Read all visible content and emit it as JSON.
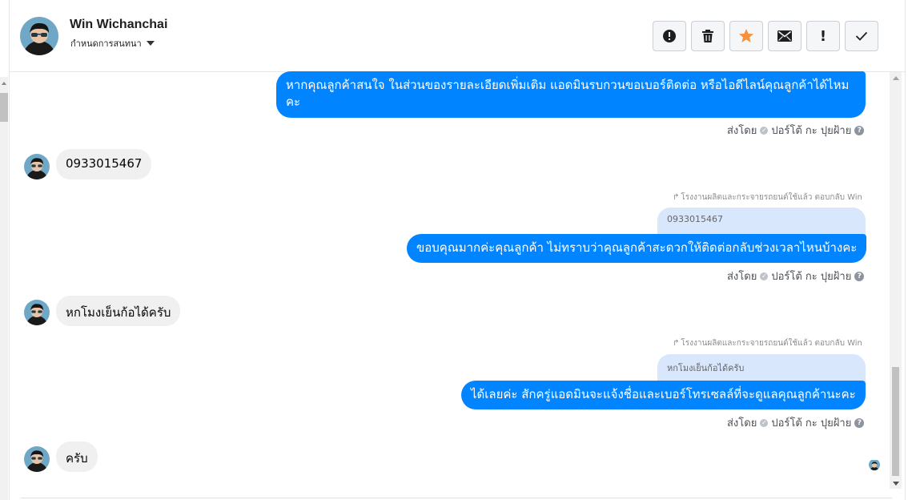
{
  "header": {
    "contact_name": "Win Wichanchai",
    "contact_subtitle": "กำหนดการสนทนา",
    "actions": [
      {
        "icon": "alert-circle-icon",
        "label": "spam"
      },
      {
        "icon": "trash-icon",
        "label": "delete"
      },
      {
        "icon": "star-icon",
        "label": "star"
      },
      {
        "icon": "envelope-icon",
        "label": "mark-unread"
      },
      {
        "icon": "exclamation-icon",
        "label": "follow-up"
      },
      {
        "icon": "check-icon",
        "label": "done"
      }
    ],
    "star_color": "#f7923b"
  },
  "messages": {
    "m1_text": "หากคุณลูกค้าสนใจ ในส่วนของรายละเอียดเพิ่มเติม แอดมินรบกวนขอเบอร์ติดต่อ หรือไอดีไลน์คุณลูกค้าได้ไหมคะ",
    "m1_sent_prefix": "ส่งโดย",
    "m1_sent_name": "ปอร์โต้ กะ ปุยฝ้าย",
    "m2_text": "0933015467",
    "m3_reply_note": "โรงงานผลิตและกระจายรถยนต์ใช้แล้ว ตอบกลับ Win",
    "m3_quote": "0933015467",
    "m3_text": "ขอบคุณมากค่ะคุณลูกค้า ไม่ทราบว่าคุณลูกค้าสะดวกให้ติดต่อกลับช่วงเวลาไหนบ้างคะ",
    "m3_sent_prefix": "ส่งโดย",
    "m3_sent_name": "ปอร์โต้ กะ ปุยฝ้าย",
    "m4_text": "หกโมงเย็นก้อได้ครับ",
    "m5_reply_note": "โรงงานผลิตและกระจายรถยนต์ใช้แล้ว ตอบกลับ Win",
    "m5_quote": "หกโมงเย็นก้อได้ครับ",
    "m5_text": "ได้เลยค่ะ สักครู่แอดมินจะแจ้งชื่อและเบอร์โทรเซลล์ที่จะดูแลคุณลูกค้านะคะ",
    "m5_sent_prefix": "ส่งโดย",
    "m5_sent_name": "ปอร์โต้ กะ ปุยฝ้าย",
    "m6_text": "ครับ"
  },
  "colors": {
    "outgoing_bubble": "#0084ff",
    "incoming_bubble": "#f0f0f0",
    "quote_bubble": "#d8e7fb"
  }
}
